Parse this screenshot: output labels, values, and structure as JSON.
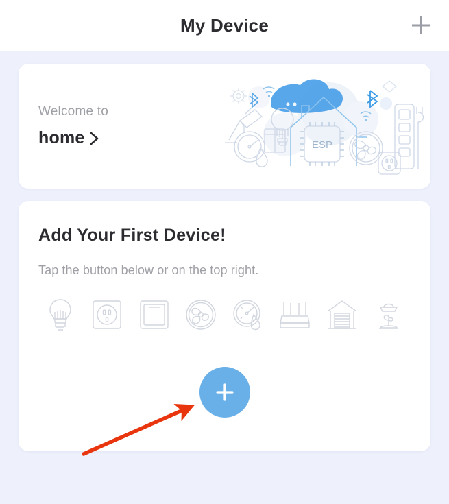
{
  "header": {
    "title": "My Device",
    "add_icon": "plus-icon"
  },
  "welcome": {
    "label": "Welcome to",
    "home_name": "home",
    "chevron_icon": "chevron-right-icon",
    "illustration": {
      "name": "smart-home-esp-illustration",
      "chip_label": "ESP",
      "elements": [
        "house-outline",
        "esp-chip",
        "light-bulb",
        "desk-lamp",
        "gauge",
        "wall-switch",
        "fan",
        "power-strip",
        "socket",
        "wifi-icon",
        "bluetooth-icon",
        "gear-icon",
        "blue-blob"
      ]
    }
  },
  "add_device": {
    "title": "Add Your First Device!",
    "subtitle": "Tap the button below or on the top right.",
    "device_icons": [
      {
        "name": "light-bulb-icon"
      },
      {
        "name": "socket-icon"
      },
      {
        "name": "switch-panel-icon"
      },
      {
        "name": "fan-icon"
      },
      {
        "name": "sensor-gauge-icon"
      },
      {
        "name": "router-icon"
      },
      {
        "name": "garage-door-icon"
      },
      {
        "name": "grow-light-icon"
      }
    ],
    "fab_icon": "plus-icon"
  },
  "annotation": {
    "arrow_color": "#e8350d",
    "points_to": "add-device-fab"
  },
  "colors": {
    "page_background": "#eef1fc",
    "card_background": "#ffffff",
    "accent_blue": "#6ab0e8",
    "title_text": "#2b2b30",
    "muted_text": "#9fa0a6",
    "icon_outline": "#d2d6de"
  }
}
